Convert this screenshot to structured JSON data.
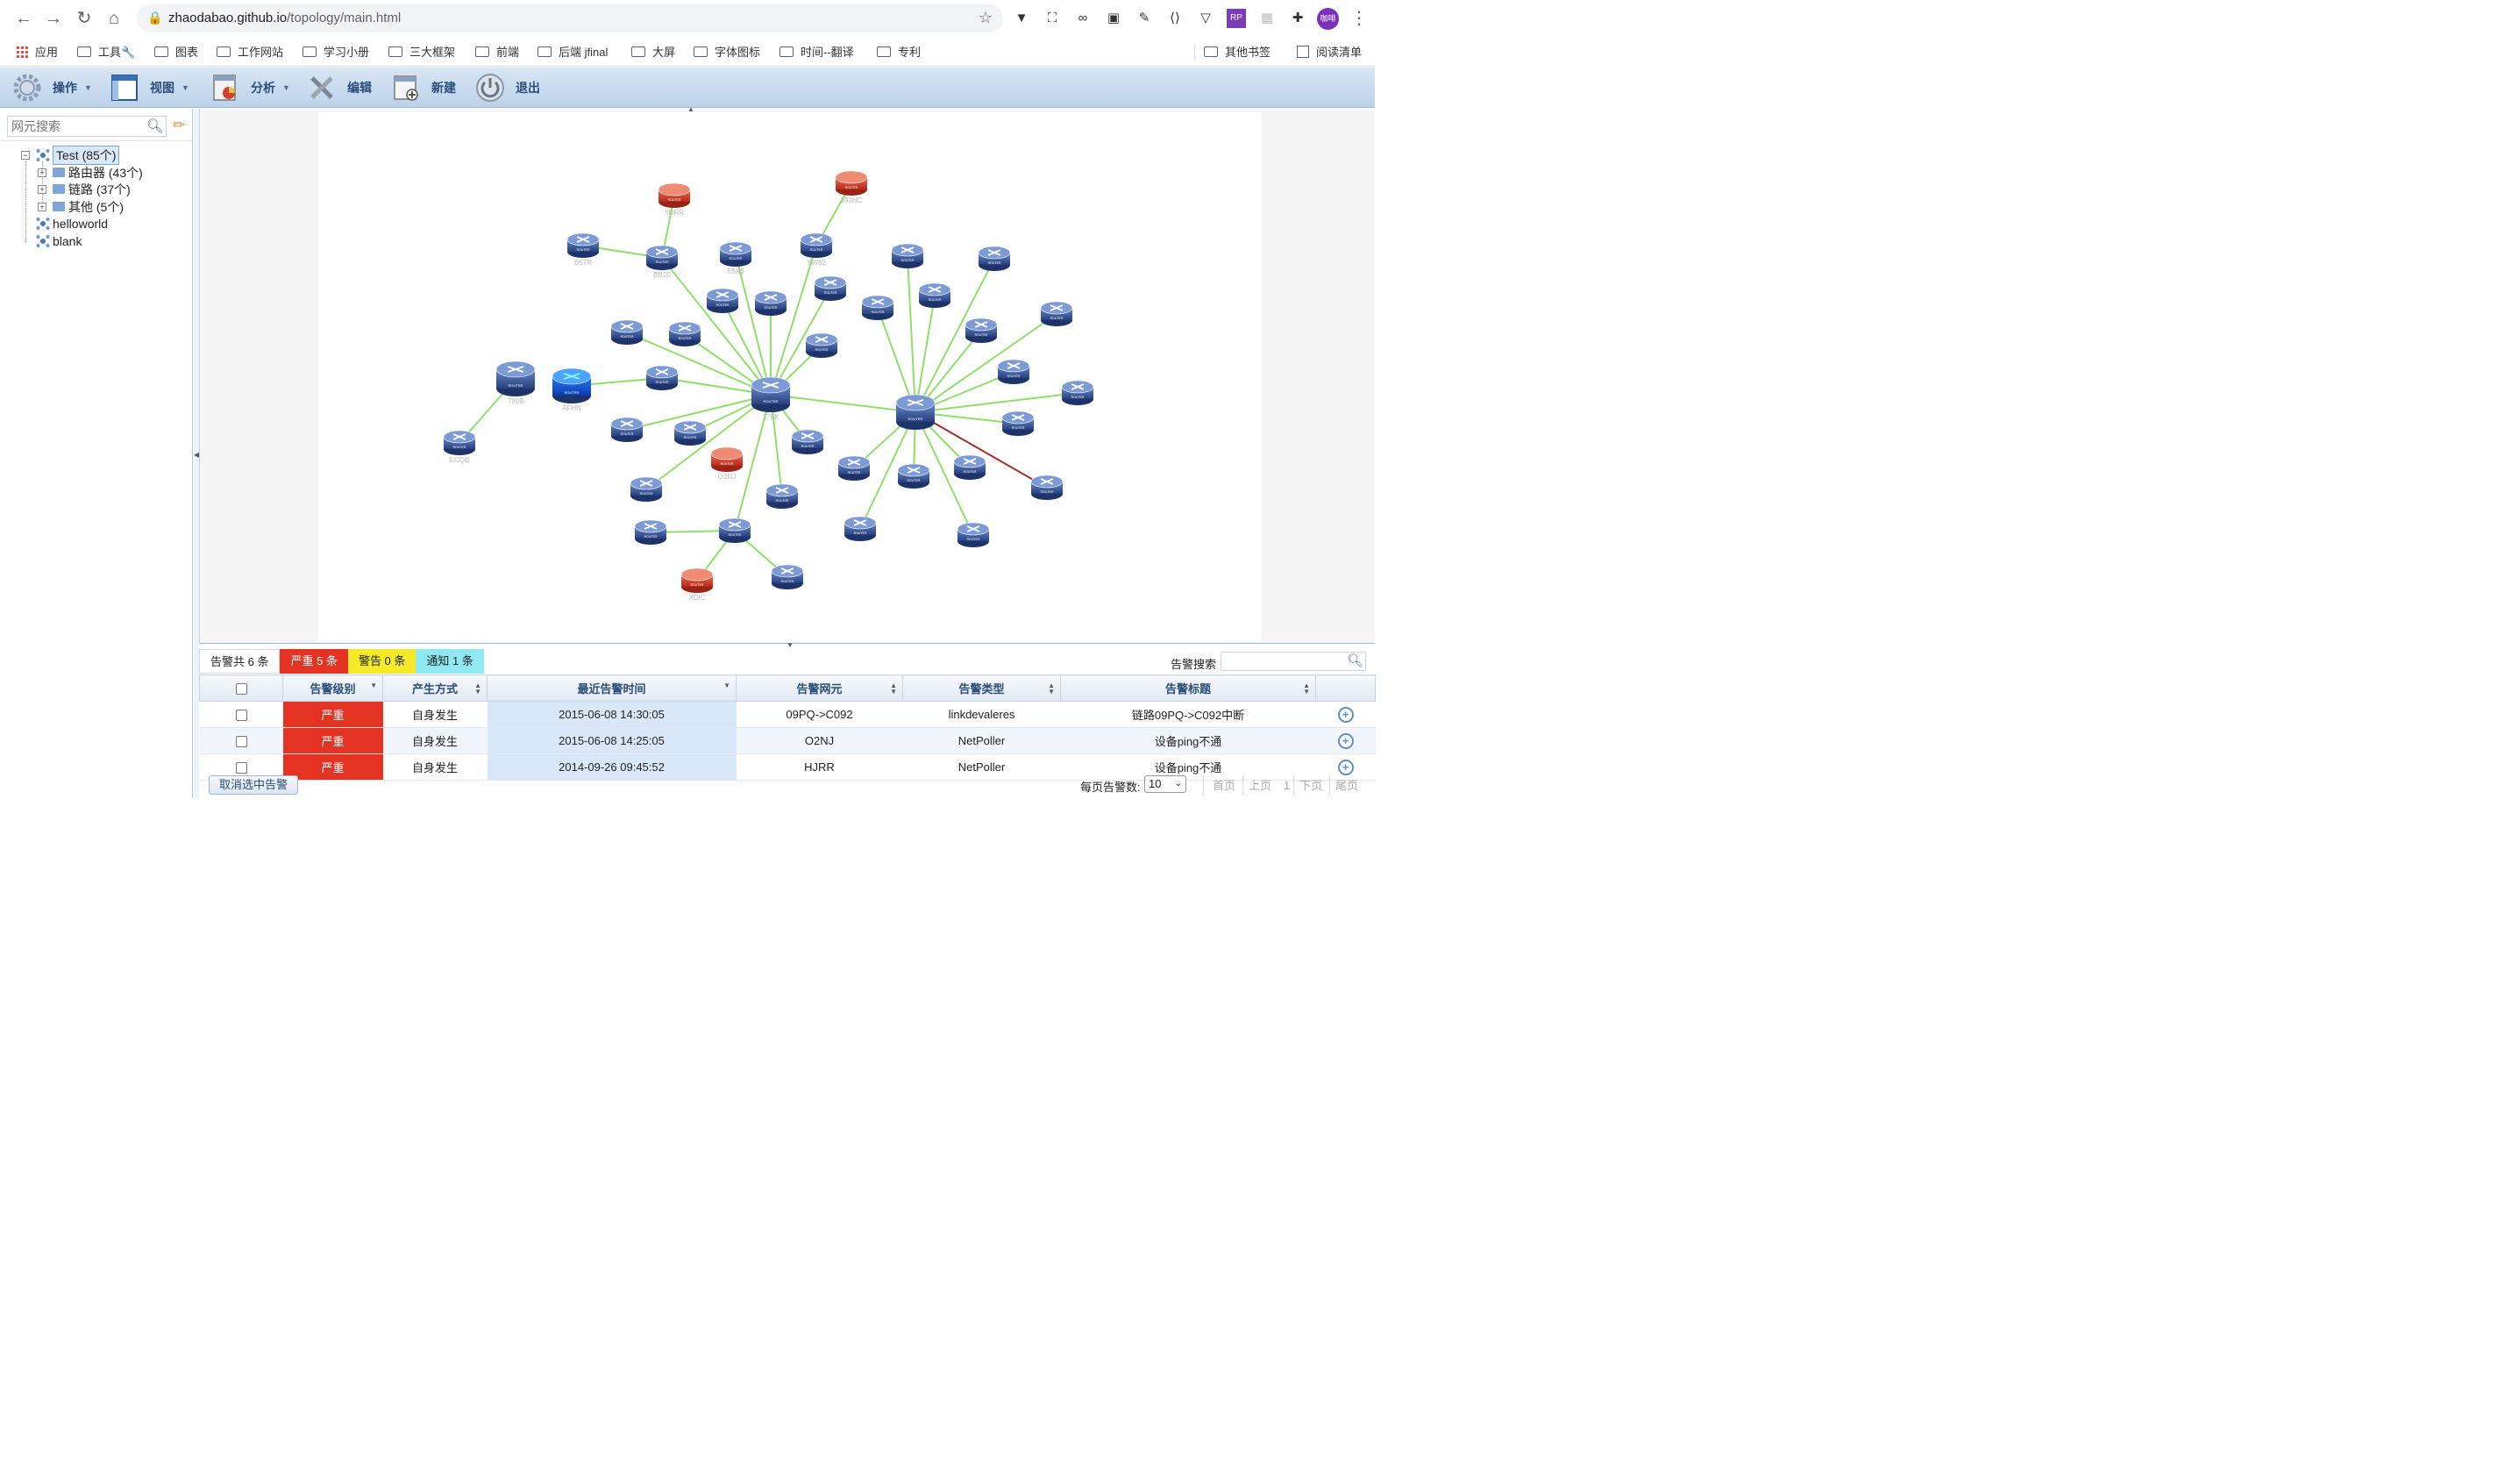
{
  "browser": {
    "url_host": "zhaodabao.github.io",
    "url_path": "/topology/main.html",
    "avatar_text": "咖啡",
    "bookmarks": [
      {
        "label": "应用",
        "type": "apps"
      },
      {
        "label": "工具🔧",
        "type": "folder"
      },
      {
        "label": "图表",
        "type": "folder"
      },
      {
        "label": "工作网站",
        "type": "folder"
      },
      {
        "label": "学习小册",
        "type": "folder"
      },
      {
        "label": "三大框架",
        "type": "folder"
      },
      {
        "label": "前端",
        "type": "folder"
      },
      {
        "label": "后端 jfinal",
        "type": "folder"
      },
      {
        "label": "大屏",
        "type": "folder"
      },
      {
        "label": "字体图标",
        "type": "folder"
      },
      {
        "label": "时间--翻译",
        "type": "folder"
      },
      {
        "label": "专利",
        "type": "folder"
      }
    ],
    "other_bookmarks": "其他书签",
    "reading_list": "阅读清单"
  },
  "toolbar": {
    "operate": "操作",
    "view": "视图",
    "analyze": "分析",
    "edit": "编辑",
    "new": "新建",
    "exit": "退出"
  },
  "sidebar": {
    "search_placeholder": "网元搜索",
    "tree": {
      "root": "Test (85个)",
      "children": [
        "路由器 (43个)",
        "链路 (37个)",
        "其他 (5个)"
      ],
      "siblings": [
        "helloworld",
        "blank"
      ]
    }
  },
  "topology": {
    "link_color": "#8ee06a",
    "alarm_link_color": "#a0312a",
    "node_color": "#3a5a9c",
    "alarm_node_color": "#e0452d",
    "node_caption": "ROUTER",
    "labels": {
      "hub1": "37FK",
      "hub2": "",
      "n_ecqb": "ECQB",
      "n_7809": "7809",
      "n_afhn": "AFHN",
      "n_b57r": "B57R",
      "n_bb20": "BB20",
      "n_5sk5": "5SK5",
      "n_r_top": "5DRR",
      "n_r_top2": "392HC",
      "n_yw82": "YW82",
      "n_r_o2nj": "O2NJ",
      "n_r_bottom": "XDIC"
    }
  },
  "alarms": {
    "total": "告警共 6 条",
    "critical": "严重 5 条",
    "warning": "警告 0 条",
    "notice": "通知 1 条",
    "search_label": "告警搜索",
    "columns": [
      "告警级别",
      "产生方式",
      "最近告警时间",
      "告警网元",
      "告警类型",
      "告警标题"
    ],
    "rows": [
      {
        "level": "严重",
        "source": "自身发生",
        "time": "2015-06-08 14:30:05",
        "element": "09PQ->C092",
        "type": "linkdevaleres",
        "title": "链路09PQ->C092中断"
      },
      {
        "level": "严重",
        "source": "自身发生",
        "time": "2015-06-08 14:25:05",
        "element": "O2NJ",
        "type": "NetPoller",
        "title": "设备ping不通"
      },
      {
        "level": "严重",
        "source": "自身发生",
        "time": "2014-09-26 09:45:52",
        "element": "HJRR",
        "type": "NetPoller",
        "title": "设备ping不通"
      }
    ],
    "clear_button": "取消选中告警",
    "per_page_label": "每页告警数:",
    "per_page_value": "10",
    "pager": {
      "first": "首页",
      "prev": "上页",
      "page": "1",
      "next": "下页",
      "last": "尾页"
    }
  }
}
